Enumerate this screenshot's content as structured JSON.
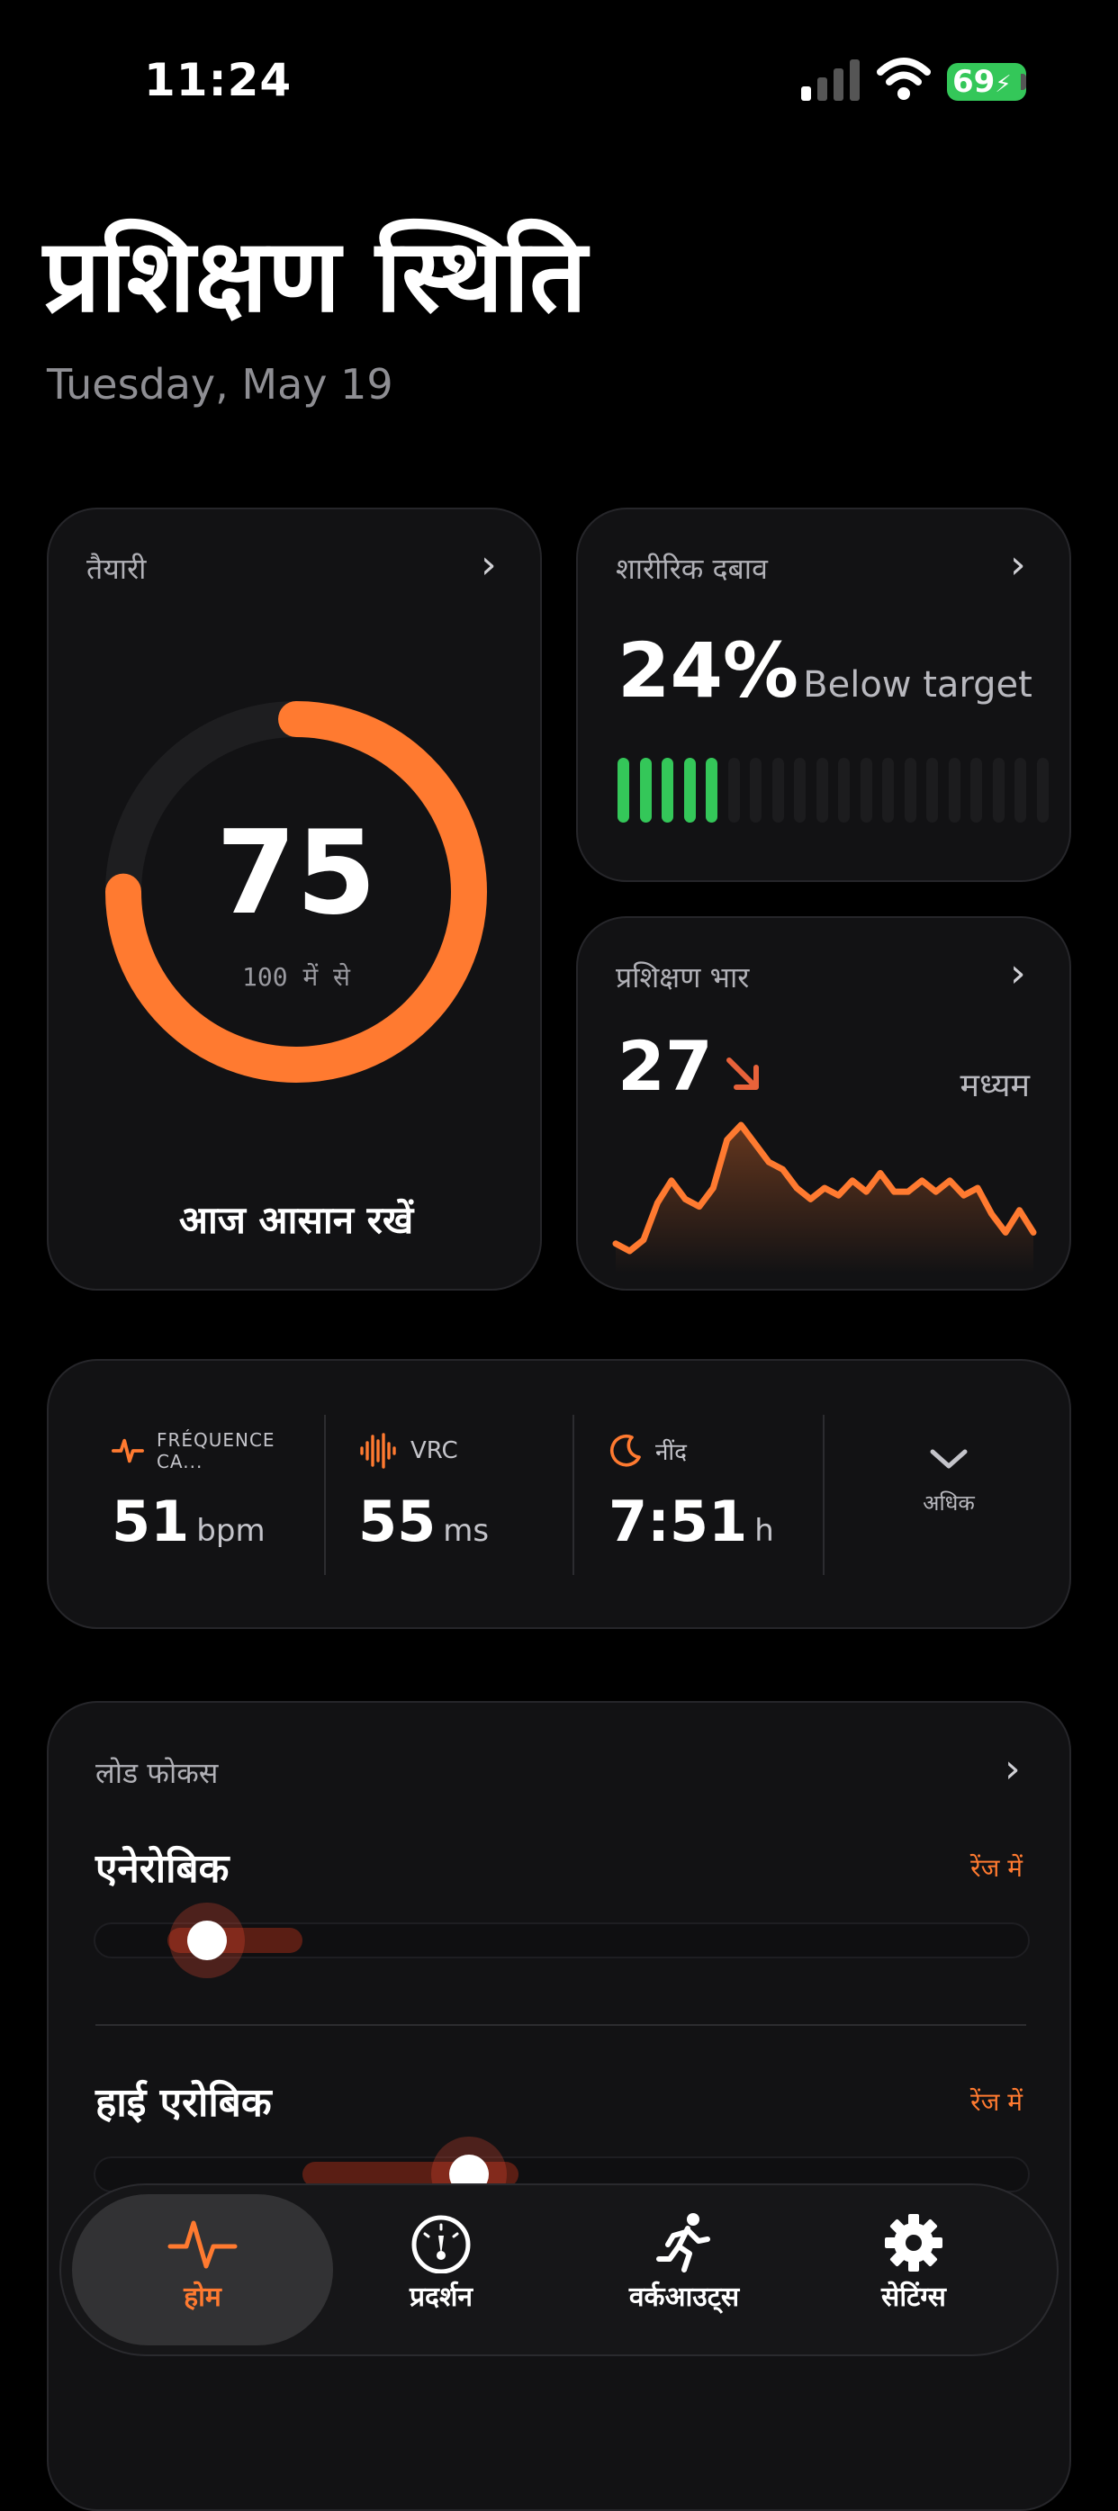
{
  "status_bar": {
    "time": "11:24",
    "battery": "69"
  },
  "header": {
    "title": "प्रशिक्षण स्थिति",
    "date": "Tuesday, May 19"
  },
  "readiness": {
    "label": "तैयारी",
    "value": "75",
    "max_text": "100 में से",
    "advice": "आज आसान रखें",
    "progress": 0.75,
    "accent": "#ff7a30"
  },
  "strain": {
    "label": "शारीरिक दबाव",
    "value": "24%",
    "status": "Below target",
    "filled_bars": 5,
    "total_bars": 20,
    "bar_color": "#34c759"
  },
  "training_load": {
    "label": "प्रशिक्षण भार",
    "value": "27",
    "trend": "down",
    "level": "मध्यम",
    "sparkline": [
      3,
      1,
      4,
      14,
      20,
      15,
      13,
      18,
      31,
      35,
      30,
      25,
      23,
      18,
      15,
      18,
      16,
      20,
      17,
      22,
      17,
      17,
      20,
      17,
      20,
      16,
      18,
      11,
      6,
      12,
      6
    ]
  },
  "metrics": [
    {
      "label": "FRÉQUENCE CA...",
      "value": "51",
      "unit": "bpm",
      "icon": "heart-pulse-icon"
    },
    {
      "label": "VRC",
      "value": "55",
      "unit": "ms",
      "icon": "waveform-icon"
    },
    {
      "label": "नींद",
      "value": "7:51",
      "unit": "h",
      "icon": "moon-icon"
    }
  ],
  "more_label": "अधिक",
  "load_focus": {
    "label": "लोड फोकस",
    "items": [
      {
        "title": "एनेरोबिक",
        "status": "रेंज में",
        "level": 0.1
      },
      {
        "title": "हाई एरोबिक",
        "status": "रेंज में",
        "level": 0.38
      }
    ]
  },
  "tabs": [
    {
      "label": "होम",
      "icon": "pulse-icon",
      "active": true
    },
    {
      "label": "प्रदर्शन",
      "icon": "gauge-icon",
      "active": false
    },
    {
      "label": "वर्कआउट्स",
      "icon": "running-icon",
      "active": false
    },
    {
      "label": "सेटिंग्स",
      "icon": "gear-icon",
      "active": false
    }
  ]
}
